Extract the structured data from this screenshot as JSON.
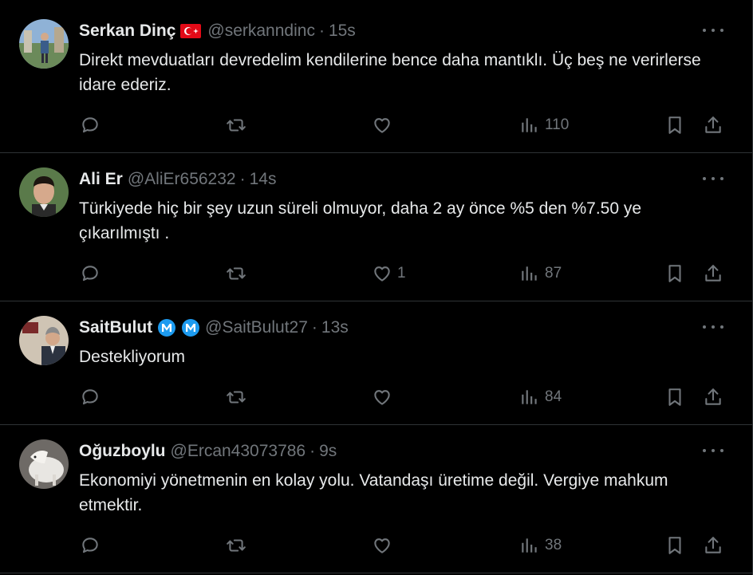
{
  "tweets": [
    {
      "name": "Serkan Dinç",
      "handle": "@serkanndinc",
      "time": "15s",
      "text": "Direkt mevduatları devredelim kendilerine bence daha mantıklı. Üç beş ne verirlerse idare ederiz.",
      "replies": "",
      "retweets": "",
      "likes": "",
      "views": "110",
      "has_flag": true,
      "badges": 0
    },
    {
      "name": "Ali Er",
      "handle": "@AliEr656232",
      "time": "14s",
      "text": "Türkiyede hiç bir şey uzun süreli olmuyor, daha 2 ay önce %5 den %7.50 ye çıkarılmıştı .",
      "replies": "",
      "retweets": "",
      "likes": "1",
      "views": "87",
      "has_flag": false,
      "badges": 0
    },
    {
      "name": "SaitBulut",
      "handle": "@SaitBulut27",
      "time": "13s",
      "text": "Destekliyorum",
      "replies": "",
      "retweets": "",
      "likes": "",
      "views": "84",
      "has_flag": false,
      "badges": 2
    },
    {
      "name": "Oğuzboylu",
      "handle": "@Ercan43073786",
      "time": "9s",
      "text": "Ekonomiyi yönetmenin en kolay yolu. Vatandaşı üretime değil. Vergiye mahkum etmektir.",
      "replies": "",
      "retweets": "",
      "likes": "",
      "views": "38",
      "has_flag": false,
      "badges": 0
    }
  ],
  "colors": {
    "background": "#000000",
    "text": "#e7e9ea",
    "muted": "#71767b",
    "border": "#2f3336",
    "badge": "#1d9bf0",
    "flag": "#e30a17"
  }
}
